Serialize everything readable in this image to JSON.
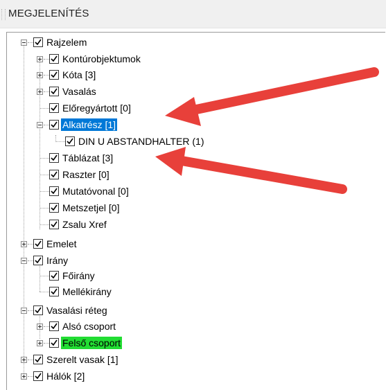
{
  "header": {
    "title": "MEGJELENÍTÉS"
  },
  "tree": {
    "rajzelem": "Rajzelem",
    "konturobjektumok": "Kontúrobjektumok",
    "kota": "Kóta [3]",
    "vasalas": "Vasalás",
    "eloregyartott": "Előregyártott [0]",
    "alkatresz": "Alkatrész [1]",
    "din": "DIN U ABSTANDHALTER (1)",
    "tablazat": "Táblázat [3]",
    "raszter": "Raszter [0]",
    "mutatovonal": "Mutatóvonal [0]",
    "metszetjel": "Metszetjel [0]",
    "zsalu": "Zsalu Xref",
    "emelet": "Emelet",
    "irany": "Irány",
    "foirany": "Főirány",
    "mellekirany": "Mellékirány",
    "vasalasi_reteg": "Vasalási réteg",
    "also_csoport": "Alsó csoport",
    "felso_csoport": "Felső csoport",
    "szerelt_vasak": "Szerelt vasak [1]",
    "halok": "Hálók [2]"
  },
  "colors": {
    "selection": "#0078d7",
    "highlight": "#22dd33",
    "arrow": "#e8403a"
  }
}
